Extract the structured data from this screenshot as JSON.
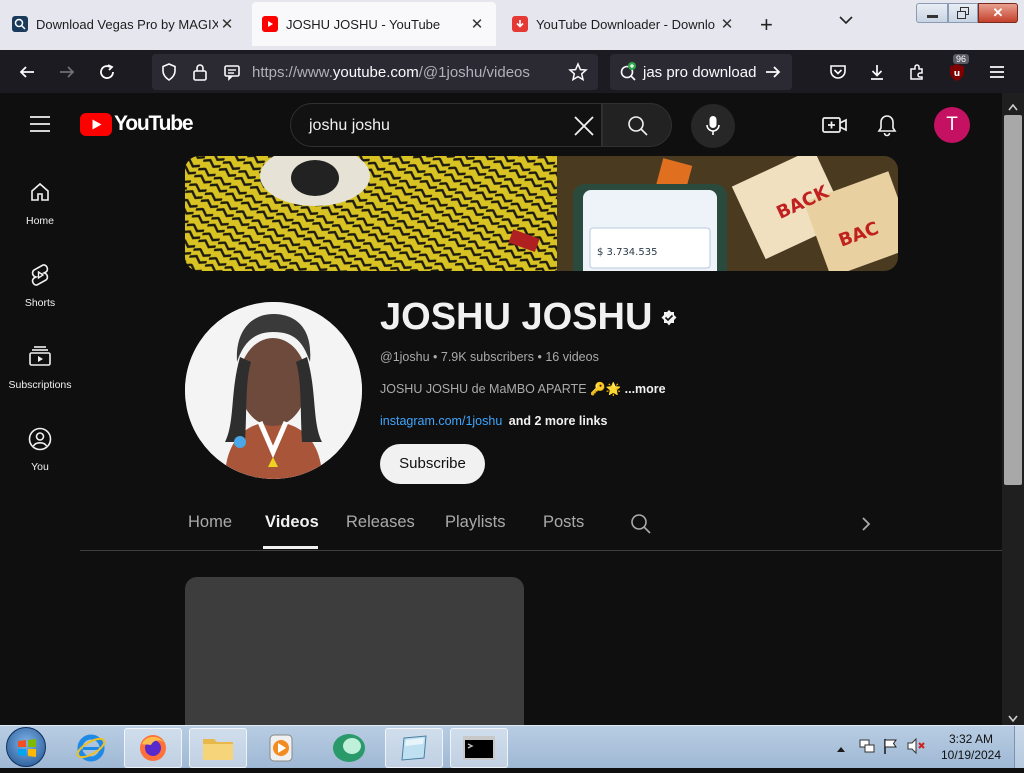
{
  "browser": {
    "tabs": [
      {
        "title": "Download Vegas Pro by MAGIX",
        "favicon": "magnifier-favicon",
        "active": false
      },
      {
        "title": "JOSHU JOSHU - YouTube",
        "favicon": "youtube-favicon",
        "active": true
      },
      {
        "title": "YouTube Downloader - Downlo",
        "favicon": "downloader-favicon",
        "active": false
      }
    ],
    "url_prefix": "https://www.",
    "url_domain": "youtube.com",
    "url_path": "/@1joshu/videos",
    "search_text": "jas pro download",
    "extension_badge": "96"
  },
  "youtube": {
    "logo_text": "YouTube",
    "search_value": "joshu joshu",
    "avatar_letter": "T",
    "sidebar": [
      {
        "label": "Home",
        "icon": "home-icon"
      },
      {
        "label": "Shorts",
        "icon": "shorts-icon"
      },
      {
        "label": "Subscriptions",
        "icon": "subscriptions-icon"
      },
      {
        "label": "You",
        "icon": "you-icon"
      }
    ],
    "channel": {
      "name": "JOSHU JOSHU",
      "handle": "@1joshu",
      "subscribers": "7.9K subscribers",
      "videos": "16 videos",
      "description": "JOSHU JOSHU de MaMBO APARTE 🔑🌟",
      "more": "...more",
      "link": "instagram.com/1joshu",
      "more_links": "and 2 more links",
      "subscribe_label": "Subscribe",
      "banner_amount": "$ 3.734.535"
    },
    "tabs": [
      "Home",
      "Videos",
      "Releases",
      "Playlists",
      "Posts"
    ],
    "active_tab": "Videos"
  },
  "taskbar": {
    "time": "3:32 AM",
    "date": "10/19/2024"
  },
  "colors": {
    "youtube_red": "#ff0000",
    "avatar_bg": "#c51162",
    "link_blue": "#3ea6ff"
  }
}
